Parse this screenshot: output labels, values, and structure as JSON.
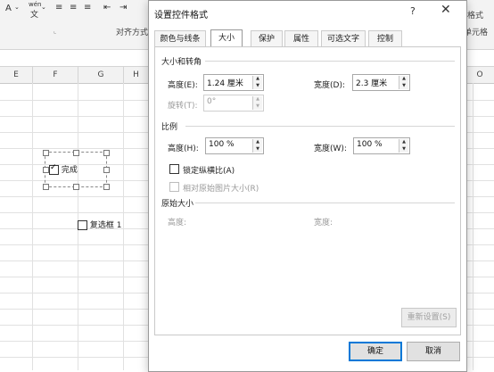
{
  "ribbon": {
    "font_buttons": [
      "A",
      "wén",
      "文"
    ],
    "align_group_label": "对齐方式",
    "right_labels": [
      "格式",
      "单元格"
    ]
  },
  "sheet": {
    "columns": [
      "E",
      "F",
      "G",
      "H",
      "O"
    ],
    "checkbox_checked_label": "完成",
    "checkbox_unchecked_label": "复选框 1"
  },
  "dialog": {
    "title": "设置控件格式",
    "help": "?",
    "close": "✕",
    "tabs": [
      "颜色与线条",
      "大小",
      "保护",
      "属性",
      "可选文字",
      "控制"
    ],
    "active_tab": "大小",
    "size_rotate": {
      "heading": "大小和转角",
      "height_label": "高度(E):",
      "height_value": "1.24 厘米",
      "width_label": "宽度(D):",
      "width_value": "2.3 厘米",
      "rotation_label": "旋转(T):",
      "rotation_value": "0°"
    },
    "scale": {
      "heading": "比例",
      "height_label": "高度(H):",
      "height_value": "100 %",
      "width_label": "宽度(W):",
      "width_value": "100 %",
      "lock_aspect_label": "锁定纵横比(A)",
      "relative_label": "相对原始图片大小(R)"
    },
    "original": {
      "heading": "原始大小",
      "height_label": "高度:",
      "width_label": "宽度:"
    },
    "reset_label": "重新设置(S)",
    "ok_label": "确定",
    "cancel_label": "取消"
  }
}
